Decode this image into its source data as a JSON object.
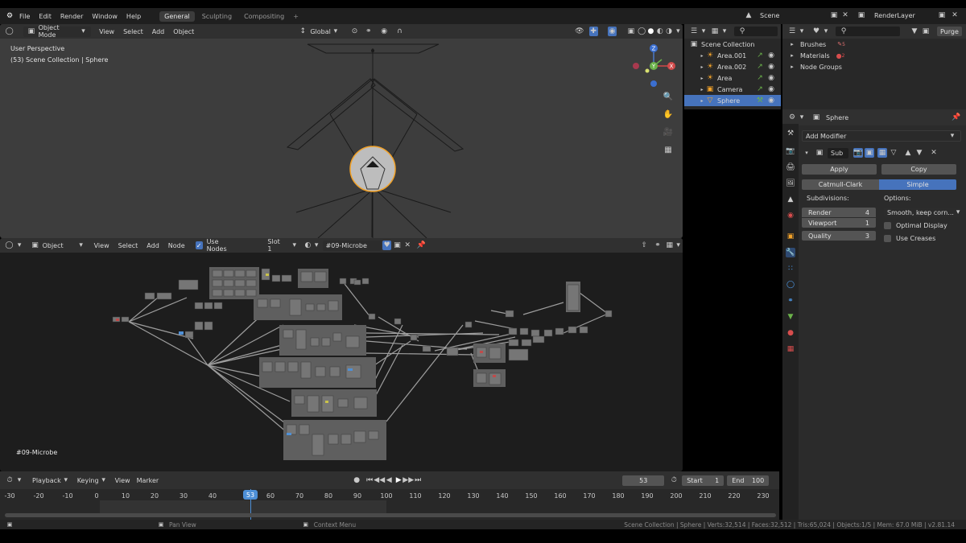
{
  "topbar": {
    "menus": [
      "File",
      "Edit",
      "Render",
      "Window",
      "Help"
    ],
    "workspaces": [
      "General",
      "Sculpting",
      "Compositing"
    ],
    "scene_label": "Scene",
    "renderlayer_label": "RenderLayer",
    "purge_label": "Purge"
  },
  "viewport": {
    "mode_label": "Object Mode",
    "menus": [
      "View",
      "Select",
      "Add",
      "Object"
    ],
    "transform_orientation": "Global",
    "overlay_line1": "User Perspective",
    "overlay_line2": "(53) Scene Collection | Sphere",
    "gizmo": {
      "z": "Z",
      "x": "X",
      "y": "Y"
    }
  },
  "node_editor": {
    "type_label": "Object",
    "menus": [
      "View",
      "Select",
      "Add",
      "Node"
    ],
    "use_nodes_label": "Use Nodes",
    "use_nodes_checked": true,
    "slot_label": "Slot 1",
    "material_name": "#09-Microbe",
    "overlay_material": "#09-Microbe"
  },
  "outliner": {
    "root": "Scene Collection",
    "items": [
      {
        "label": "Area.001",
        "selected": false
      },
      {
        "label": "Area.002",
        "selected": false
      },
      {
        "label": "Area",
        "selected": false
      },
      {
        "label": "Camera",
        "selected": false
      },
      {
        "label": "Sphere",
        "selected": true
      }
    ]
  },
  "datablocks": {
    "items": [
      "Brushes",
      "Materials",
      "Node Groups"
    ],
    "badges": {
      "brushes": "5",
      "materials": "2"
    }
  },
  "properties": {
    "object_name": "Sphere",
    "add_modifier_label": "Add Modifier",
    "modifier_name": "Sub",
    "apply_label": "Apply",
    "copy_label": "Copy",
    "type_options": [
      "Catmull-Clark",
      "Simple"
    ],
    "type_selected": "Simple",
    "subdivisions_label": "Subdivisions:",
    "render_label": "Render",
    "render_value": "4",
    "viewport_label": "Viewport",
    "viewport_value": "1",
    "quality_label": "Quality",
    "quality_value": "3",
    "options_label": "Options:",
    "uv_smooth_value": "Smooth, keep corn...",
    "optimal_display_label": "Optimal Display",
    "use_creases_label": "Use Creases"
  },
  "timeline": {
    "menus": [
      "Playback",
      "Keying",
      "View",
      "Marker"
    ],
    "current_frame": "53",
    "start_label": "Start",
    "start_value": "1",
    "end_label": "End",
    "end_value": "100",
    "ticks": [
      "-30",
      "-20",
      "-10",
      "0",
      "10",
      "20",
      "30",
      "40",
      "50",
      "60",
      "70",
      "80",
      "90",
      "100",
      "110",
      "120",
      "130",
      "140",
      "150",
      "160",
      "170",
      "180",
      "190",
      "200",
      "210",
      "220",
      "230"
    ],
    "playhead_label": "53"
  },
  "statusbar": {
    "pan_view": "Pan View",
    "context_menu": "Context Menu",
    "stats": "Scene Collection | Sphere | Verts:32,514 | Faces:32,512 | Tris:65,024 | Objects:1/5 | Mem: 67.0 MiB | v2.81.14"
  },
  "colors": {
    "accent_blue": "#4673bc",
    "selection_orange": "#f2a229",
    "playhead_blue": "#4d8fd6"
  }
}
